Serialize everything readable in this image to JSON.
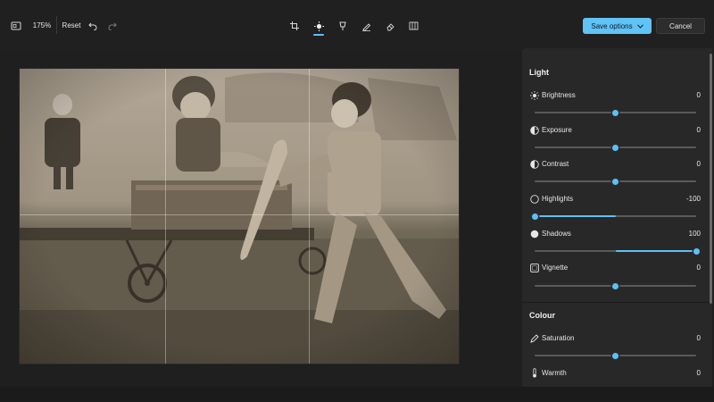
{
  "toolbar": {
    "zoom_label": "175%",
    "reset_label": "Reset",
    "save_label": "Save options",
    "cancel_label": "Cancel",
    "icons": [
      "aspect-ratio-icon",
      "undo-icon",
      "redo-icon",
      "crop-icon",
      "adjust-icon",
      "filter-icon",
      "markup-icon",
      "erase-icon",
      "background-icon",
      "chevron-down-icon"
    ],
    "active_tool": "adjust"
  },
  "colors": {
    "accent": "#5cc1f5",
    "panel_bg": "#282828",
    "app_bg": "#1f1f1f"
  },
  "panel": {
    "light_title": "Light",
    "colour_title": "Colour",
    "light": [
      {
        "label": "Brightness",
        "value": "0",
        "icon": "brightness-icon",
        "level": 0.5
      },
      {
        "label": "Exposure",
        "value": "0",
        "icon": "exposure-icon",
        "level": 0.5
      },
      {
        "label": "Contrast",
        "value": "0",
        "icon": "contrast-icon",
        "level": 0.5
      },
      {
        "label": "Highlights",
        "value": "-100",
        "icon": "highlights-icon",
        "level": 0.0
      },
      {
        "label": "Shadows",
        "value": "100",
        "icon": "shadows-icon",
        "level": 1.0
      },
      {
        "label": "Vignette",
        "value": "0",
        "icon": "vignette-icon",
        "level": 0.5
      }
    ],
    "colour": [
      {
        "label": "Saturation",
        "value": "0",
        "icon": "saturation-icon",
        "level": 0.5
      },
      {
        "label": "Warmth",
        "value": "0",
        "icon": "warmth-icon",
        "level": 0.5
      }
    ]
  }
}
